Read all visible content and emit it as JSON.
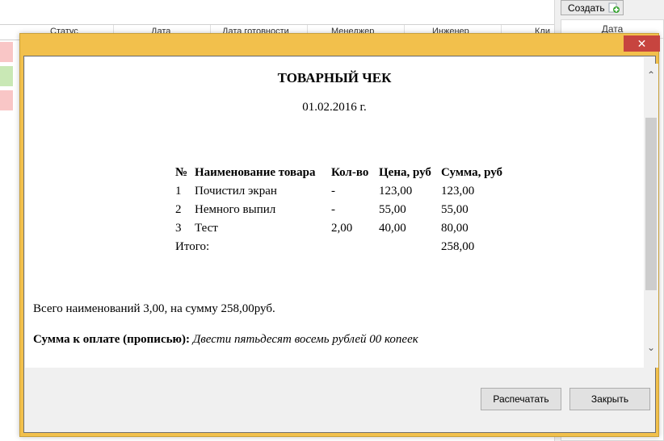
{
  "background": {
    "columns": [
      "Статус",
      "Дата",
      "Дата готовности",
      "Менеджер",
      "Инженер",
      "Кли"
    ],
    "create_label": "Создать",
    "side_header": "Дата"
  },
  "dialog": {
    "close_glyph": "✕",
    "title": "ТОВАРНЫЙ ЧЕК",
    "date": "01.02.2016 г.",
    "table": {
      "headers": [
        "№",
        "Наименование товара",
        "Кол-во",
        "Цена, руб",
        "Сумма, руб"
      ],
      "rows": [
        [
          "1",
          "Почистил экран",
          "-",
          "123,00",
          "123,00"
        ],
        [
          "2",
          "Немного выпил",
          "-",
          "55,00",
          "55,00"
        ],
        [
          "3",
          "Тест",
          "2,00",
          "40,00",
          "80,00"
        ]
      ],
      "total_label": "Итого:",
      "total_value": "258,00"
    },
    "summary": "Всего наименований 3,00, на сумму 258,00руб.",
    "words_label": "Сумма к оплате (прописью):",
    "words_value": "Двести пятьдесят восемь рублей 00 копеек",
    "print_label": "Распечатать",
    "close_label": "Закрыть"
  },
  "colors": {
    "dialog_frame": "#f2c04c",
    "close_button": "#c7443f",
    "row_red": "#f9c6c6",
    "row_green": "#c9e8b5"
  }
}
